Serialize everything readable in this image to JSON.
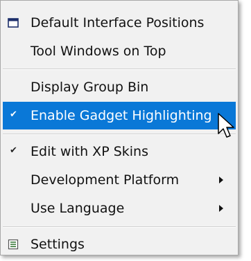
{
  "menu": {
    "items": [
      {
        "label": "Default Interface Positions",
        "icon": "window-icon"
      },
      {
        "label": "Tool Windows on Top"
      },
      {
        "label": "Display Group Bin"
      },
      {
        "label": "Enable Gadget Highlighting",
        "checked": true,
        "highlighted": true
      },
      {
        "label": "Edit with XP Skins",
        "checked": true
      },
      {
        "label": "Development Platform",
        "submenu": true
      },
      {
        "label": "Use Language",
        "submenu": true
      },
      {
        "label": "Settings",
        "icon": "settings-icon"
      }
    ],
    "check_glyph": "✔",
    "highlight_color": "#0a78d7"
  }
}
